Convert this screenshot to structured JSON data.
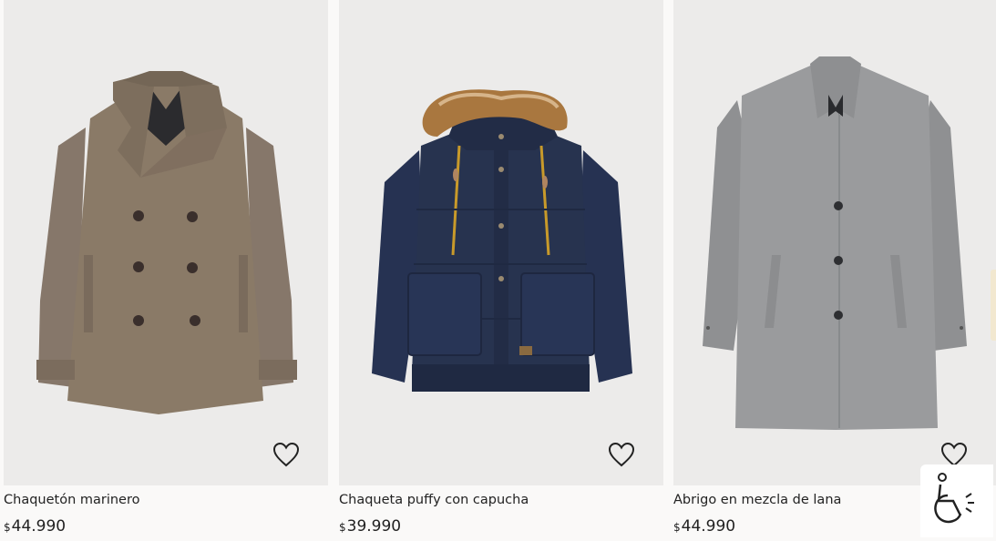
{
  "products": [
    {
      "name": "Chaquetón marinero",
      "currency": "$",
      "price": "44.990",
      "favorite_icon": "heart-outline-icon"
    },
    {
      "name": "Chaqueta puffy con capucha",
      "currency": "$",
      "price": "39.990",
      "favorite_icon": "heart-outline-icon"
    },
    {
      "name": "Abrigo en mezcla de lana",
      "currency": "$",
      "price": "44.990",
      "favorite_icon": "heart-outline-icon"
    }
  ],
  "accessibility_widget": {
    "icon": "accessibility-icon"
  },
  "colors": {
    "background": "#faf9f8",
    "image_background": "#ecebea",
    "text": "#222222",
    "peacoat": "#8a7a67",
    "puffer": "#27334f",
    "fur": "#a9773f",
    "wool_coat": "#9a9b9d"
  }
}
